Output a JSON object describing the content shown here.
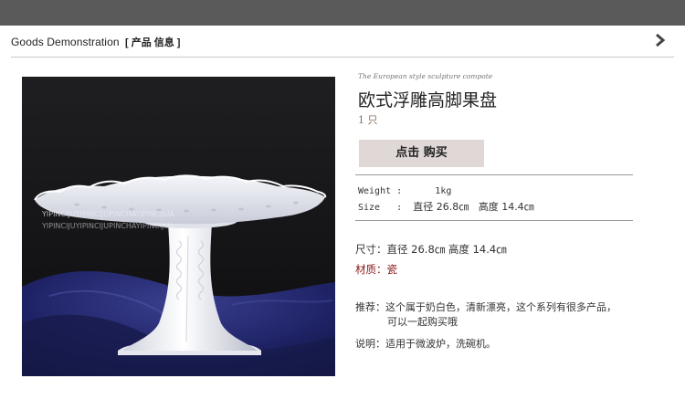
{
  "header": {
    "title_en": "Goods  Demonstration",
    "title_cn": "[ 产品 信息 ]",
    "next_icon": "chevron-right-icon"
  },
  "product": {
    "image": {
      "watermark_line1": "YIPINCIJUYIPINCIJUPINCHAYIPINCIJUA",
      "watermark_line2": "YIPINCIJUYIPINCIJUPINCHAYIPINCIJUA"
    },
    "subtitle": "The European style sculpture compote",
    "name": "欧式浮雕高脚果盘",
    "quantity": "1 只",
    "buy_button_label": "点击 购买"
  },
  "specs": {
    "weight_label": "Weight :",
    "weight_value": "1kg",
    "size_label": "Size   :",
    "size_value": "直径 26.8㎝   高度 14.4㎝"
  },
  "details": {
    "size_label": "尺寸：",
    "size_value": "直径 26.8㎝   高度 14.4㎝",
    "material_label": "材质：",
    "material_value": "瓷"
  },
  "notes": {
    "recommend_label": "推荐：",
    "recommend_line1": "这个属于奶白色，清新漂亮，这个系列有很多产品，",
    "recommend_line2": "可以一起购买哦",
    "usage_label": "说明：",
    "usage_value": "适用于微波炉，洗碗机。"
  },
  "colors": {
    "topbar": "#5a5a5a",
    "button_bg": "#e0d8d6",
    "material_text": "#8b1a1a"
  }
}
